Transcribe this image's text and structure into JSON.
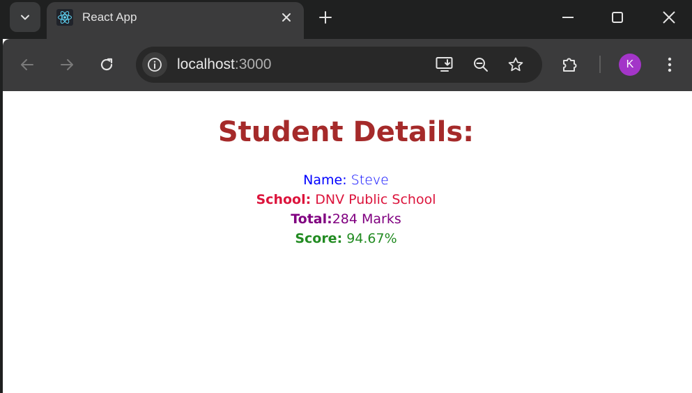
{
  "browser": {
    "tab": {
      "title": "React App",
      "favicon": "react-logo-icon"
    },
    "address": {
      "host": "localhost",
      "port": ":3000"
    },
    "profile_initial": "K",
    "colors": {
      "frame": "#1f2020",
      "toolbar": "#3b3b3c",
      "omnibox": "#282828",
      "avatar": "#a335c8"
    }
  },
  "page": {
    "heading": "Student Details:",
    "name": {
      "label": "Name:",
      "value": " Steve",
      "color": "#0000ff"
    },
    "school": {
      "label": "School:",
      "value": " DNV Public School",
      "color": "#dc143c"
    },
    "total": {
      "label": "Total:",
      "value": "284 Marks",
      "color": "#800080"
    },
    "score": {
      "label": "Score:",
      "value": " 94.67%",
      "color": "#228b22"
    },
    "heading_color": "#a52a2a"
  }
}
